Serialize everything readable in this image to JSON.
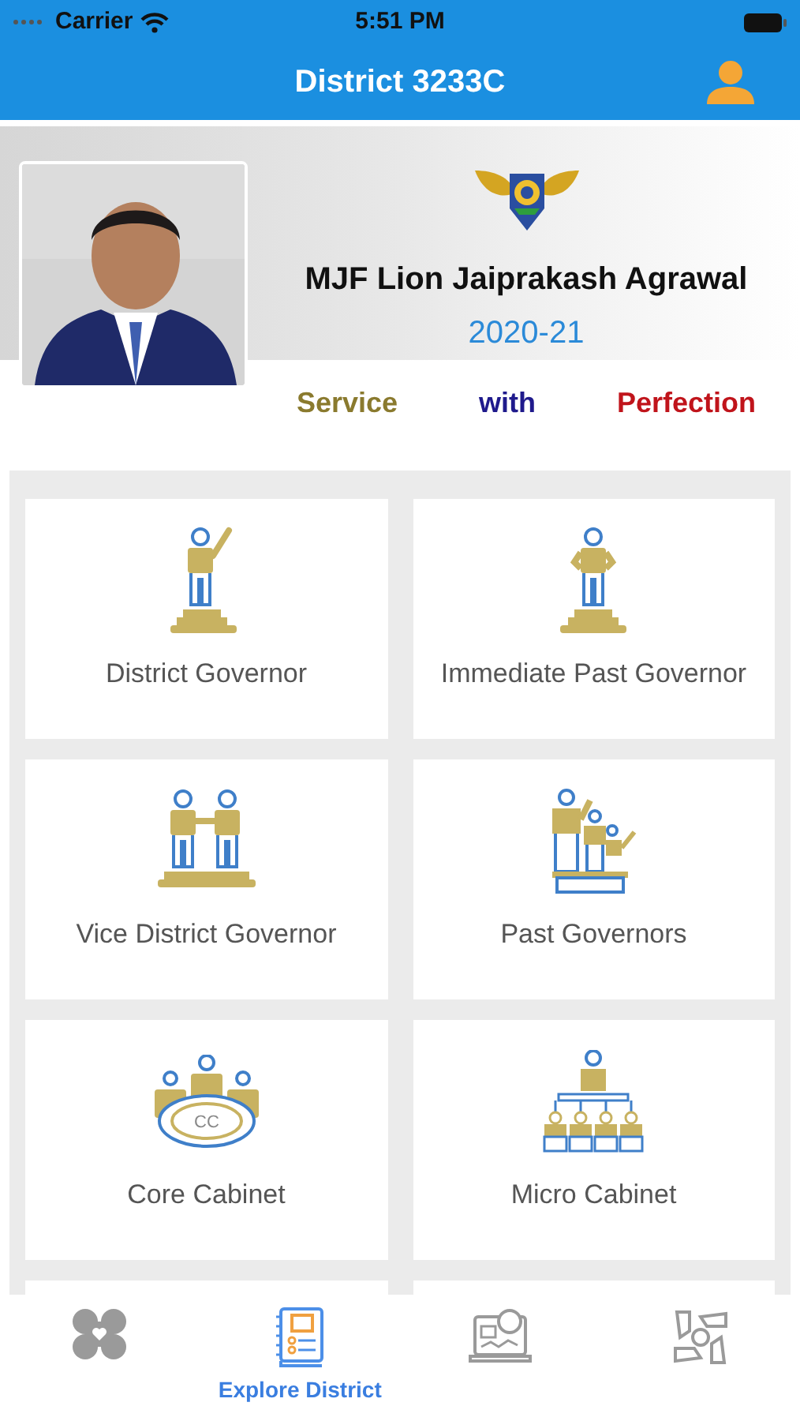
{
  "status_bar": {
    "carrier": "Carrier",
    "time": "5:51 PM"
  },
  "header": {
    "title": "District 3233C"
  },
  "profile": {
    "name": "MJF Lion Jaiprakash Agrawal",
    "year": "2020-21"
  },
  "tagline": [
    {
      "text": "Service",
      "color": "#8a7a2e"
    },
    {
      "text": "with",
      "color": "#1f1a8c"
    },
    {
      "text": "Perfection",
      "color": "#c0141b"
    }
  ],
  "cards": [
    {
      "label": "District Governor",
      "kind": "raised-hand"
    },
    {
      "label": "Immediate Past Governor",
      "kind": "hands-on-hips"
    },
    {
      "label": "Vice District Governor",
      "kind": "handshake"
    },
    {
      "label": "Past Governors",
      "kind": "podium-group"
    },
    {
      "label": "Core Cabinet",
      "kind": "round-table",
      "icon_text": "CC"
    },
    {
      "label": "Micro Cabinet",
      "kind": "org-chart"
    }
  ],
  "tab_bar": [
    {
      "kind": "ribbons",
      "selected": false
    },
    {
      "kind": "book",
      "label": "Explore District",
      "selected": true
    },
    {
      "kind": "laptop",
      "selected": false
    },
    {
      "kind": "hands",
      "selected": false
    }
  ]
}
